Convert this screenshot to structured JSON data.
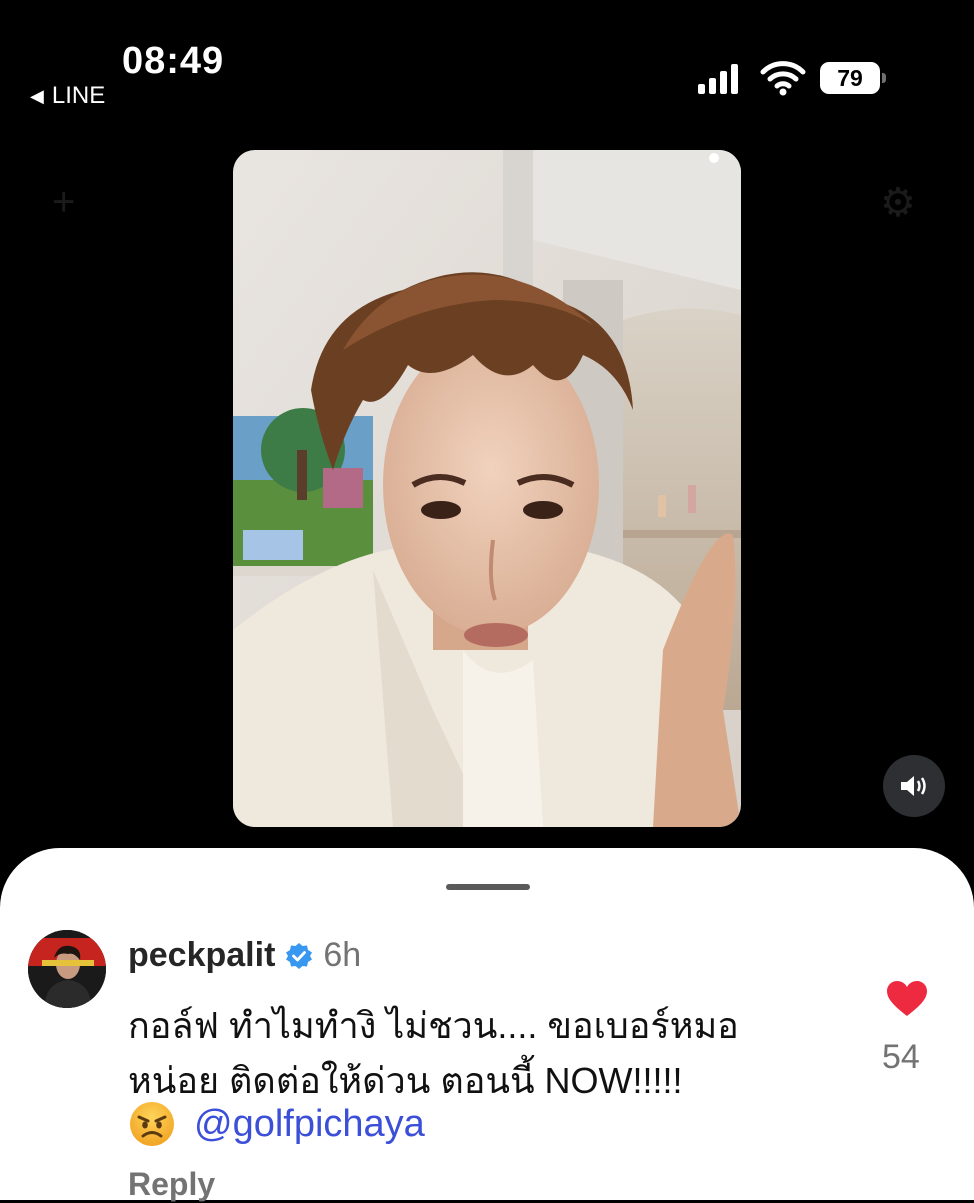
{
  "status_bar": {
    "time": "08:49",
    "back_app": "LINE",
    "battery": "79"
  },
  "comment": {
    "username": "peckpalit",
    "time_ago": "6h",
    "text_line1": "กอล์ฟ ทำไมทำงิ ไม่ชวน.... ขอเบอร์หมอ",
    "text_line2": "หน่อย ติดต่อให้ด่วน ตอนนี้ NOW!!!!!",
    "mention": "@golfpichaya",
    "reply_label": "Reply",
    "like_count": "54"
  },
  "colors": {
    "heart": "#ed2a3f",
    "mention": "#3b4fd8",
    "verified": "#3897f0"
  },
  "icons": [
    "back-arrow-icon",
    "signal-icon",
    "wifi-icon",
    "battery-icon",
    "sound-icon",
    "verified-badge-icon",
    "heart-icon",
    "angry-emoji-icon"
  ]
}
